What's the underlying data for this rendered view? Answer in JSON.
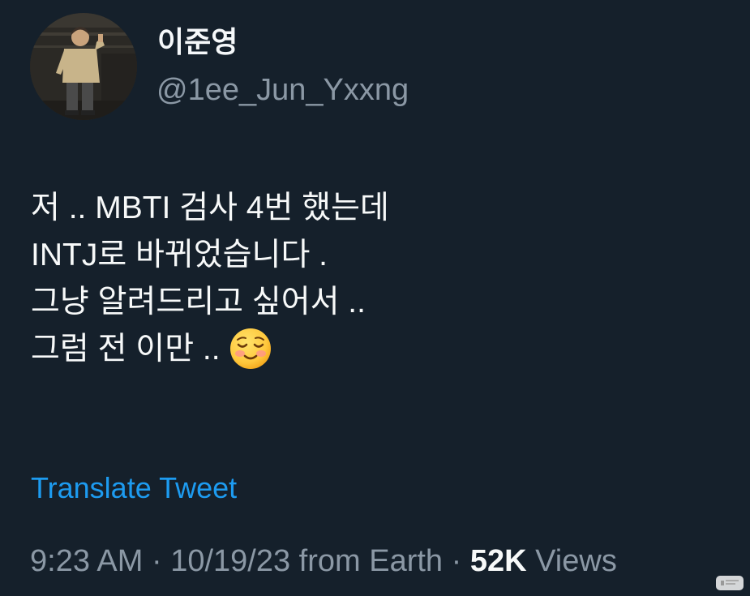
{
  "user": {
    "display_name": "이준영",
    "handle": "@1ee_Jun_Yxxng"
  },
  "tweet": {
    "lines": [
      "저 .. MBTI 검사 4번 했는데",
      "INTJ로 바뀌었습니다 .",
      "그냥 알려드리고 싶어서 ..",
      "그럼 전 이만 .."
    ],
    "emoji_icon": "smiling-face-icon",
    "translate_label": "Translate Tweet"
  },
  "meta": {
    "time": "9:23 AM",
    "sep1": " · ",
    "date": "10/19/23",
    "source": " from Earth",
    "sep2": " · ",
    "views_count": "52K",
    "views_label": " Views"
  },
  "colors": {
    "background": "#15202b",
    "link": "#1d9bf0",
    "secondary_text": "#8b98a5",
    "primary_text": "#f7f9f9"
  },
  "watermark_icon": "watermark-icon"
}
